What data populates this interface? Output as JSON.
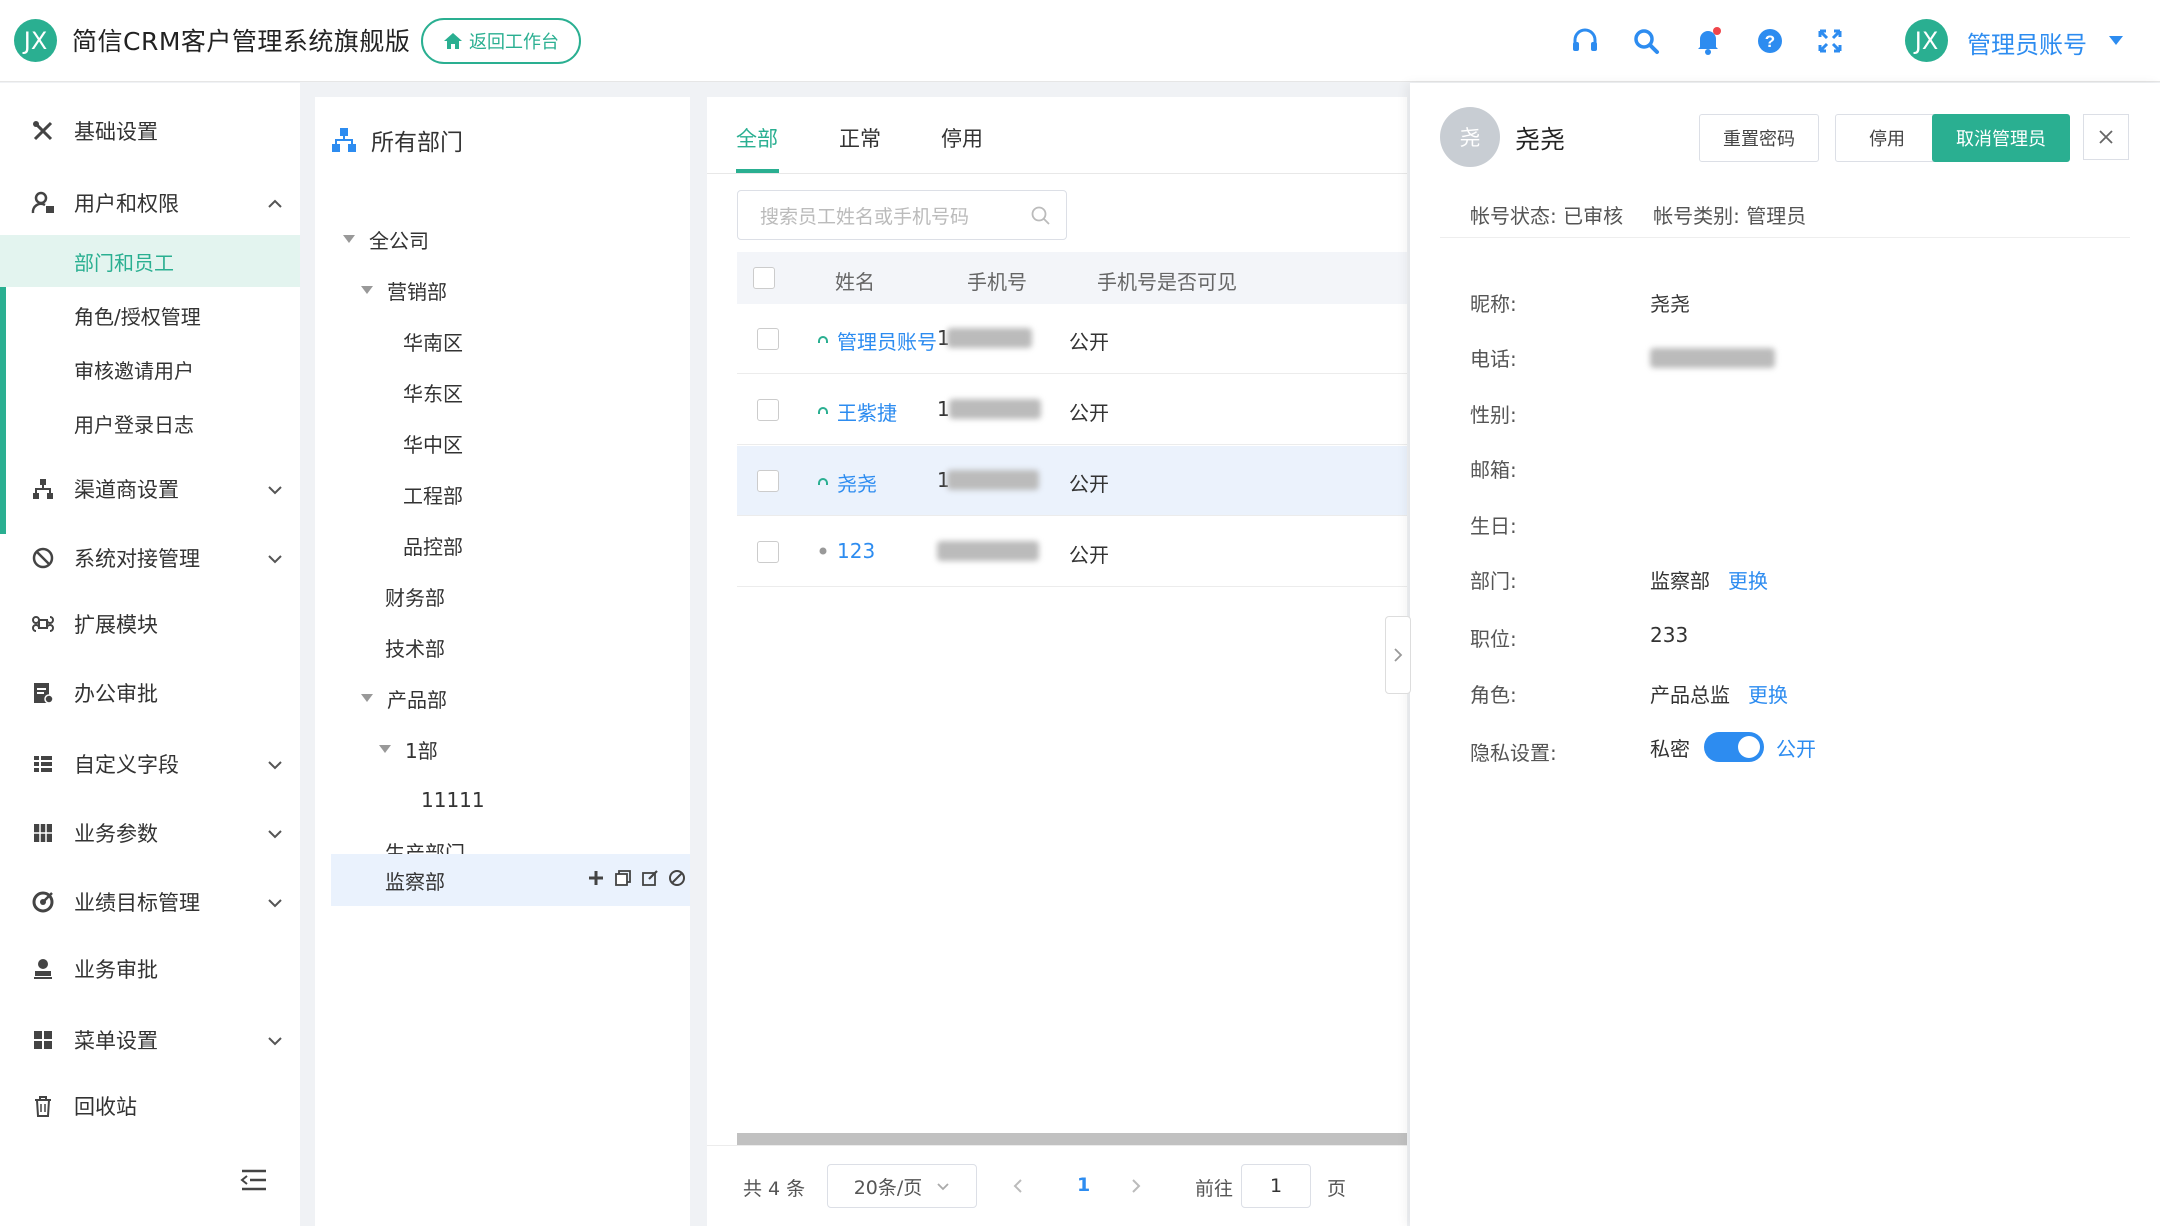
{
  "app": {
    "logo_text": "JX",
    "title": "简信CRM客户管理系统旗舰版",
    "back_label": "返回工作台"
  },
  "user": {
    "avatar_text": "JX",
    "name": "管理员账号"
  },
  "colors": {
    "brand": "#2aaf91",
    "link": "#2d8cf0"
  },
  "sidebar": {
    "items": [
      {
        "label": "基础设置",
        "icon": "wrench-icon"
      },
      {
        "label": "用户和权限",
        "icon": "user-lock-icon"
      },
      {
        "label": "渠道商设置",
        "icon": "org-tree-icon"
      },
      {
        "label": "系统对接管理",
        "icon": "link-icon"
      },
      {
        "label": "扩展模块",
        "icon": "command-icon"
      },
      {
        "label": "办公审批",
        "icon": "doc-check-icon"
      },
      {
        "label": "自定义字段",
        "icon": "list-icon"
      },
      {
        "label": "业务参数",
        "icon": "grid-icon"
      },
      {
        "label": "业绩目标管理",
        "icon": "target-icon"
      },
      {
        "label": "业务审批",
        "icon": "stamp-icon"
      },
      {
        "label": "菜单设置",
        "icon": "menu-grid-icon"
      },
      {
        "label": "回收站",
        "icon": "trash-icon"
      }
    ],
    "subitems": [
      "部门和员工",
      "角色/授权管理",
      "审核邀请用户",
      "用户登录日志"
    ]
  },
  "dept": {
    "header": "所有部门",
    "nodes": [
      "全公司",
      "营销部",
      "华南区",
      "华东区",
      "华中区",
      "工程部",
      "品控部",
      "财务部",
      "技术部",
      "产品部",
      "1部",
      "11111",
      "生产部门",
      "监察部"
    ]
  },
  "list": {
    "tabs": [
      "全部",
      "正常",
      "停用"
    ],
    "search_placeholder": "搜索员工姓名或手机号码",
    "columns": [
      "姓名",
      "手机号",
      "手机号是否可见"
    ],
    "rows": [
      {
        "name": "管理员账号",
        "phone": "1",
        "visible": "公开"
      },
      {
        "name": "王紫捷",
        "phone": "1",
        "visible": "公开"
      },
      {
        "name": "尧尧",
        "phone": "1",
        "visible": "公开"
      },
      {
        "name": "123",
        "phone": "",
        "visible": "公开"
      }
    ],
    "pager": {
      "total": "共 4 条",
      "page_size": "20条/页",
      "page": "1",
      "goto_label": "前往",
      "goto_value": "1",
      "page_suffix": "页"
    }
  },
  "detail": {
    "avatar_text": "尧",
    "name": "尧尧",
    "buttons": {
      "reset": "重置密码",
      "disable": "停用",
      "cancel_admin": "取消管理员"
    },
    "status": "帐号状态: 已审核",
    "type": "帐号类别: 管理员",
    "fields": {
      "nickname_label": "昵称:",
      "nickname": "尧尧",
      "phone_label": "电话:",
      "gender_label": "性别:",
      "email_label": "邮箱:",
      "birthday_label": "生日:",
      "dept_label": "部门:",
      "dept": "监察部",
      "dept_change": "更换",
      "position_label": "职位:",
      "position": "233",
      "role_label": "角色:",
      "role": "产品总监",
      "role_change": "更换",
      "privacy_label": "隐私设置:",
      "privacy_off": "私密",
      "privacy_on": "公开"
    }
  }
}
